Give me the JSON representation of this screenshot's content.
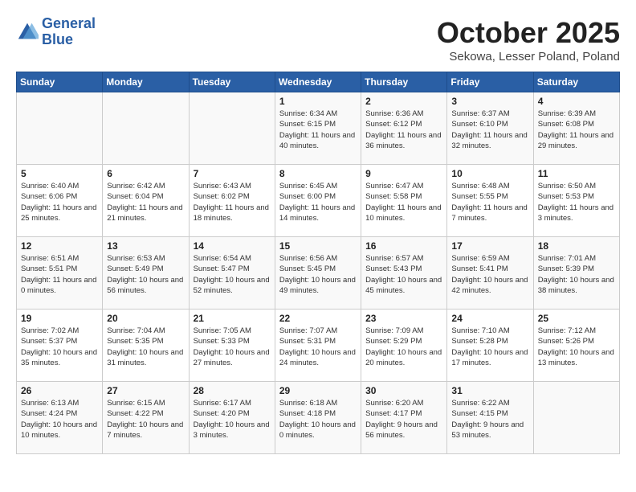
{
  "header": {
    "logo_line1": "General",
    "logo_line2": "Blue",
    "month": "October 2025",
    "location": "Sekowa, Lesser Poland, Poland"
  },
  "weekdays": [
    "Sunday",
    "Monday",
    "Tuesday",
    "Wednesday",
    "Thursday",
    "Friday",
    "Saturday"
  ],
  "weeks": [
    [
      {
        "day": "",
        "info": ""
      },
      {
        "day": "",
        "info": ""
      },
      {
        "day": "",
        "info": ""
      },
      {
        "day": "1",
        "info": "Sunrise: 6:34 AM\nSunset: 6:15 PM\nDaylight: 11 hours\nand 40 minutes."
      },
      {
        "day": "2",
        "info": "Sunrise: 6:36 AM\nSunset: 6:12 PM\nDaylight: 11 hours\nand 36 minutes."
      },
      {
        "day": "3",
        "info": "Sunrise: 6:37 AM\nSunset: 6:10 PM\nDaylight: 11 hours\nand 32 minutes."
      },
      {
        "day": "4",
        "info": "Sunrise: 6:39 AM\nSunset: 6:08 PM\nDaylight: 11 hours\nand 29 minutes."
      }
    ],
    [
      {
        "day": "5",
        "info": "Sunrise: 6:40 AM\nSunset: 6:06 PM\nDaylight: 11 hours\nand 25 minutes."
      },
      {
        "day": "6",
        "info": "Sunrise: 6:42 AM\nSunset: 6:04 PM\nDaylight: 11 hours\nand 21 minutes."
      },
      {
        "day": "7",
        "info": "Sunrise: 6:43 AM\nSunset: 6:02 PM\nDaylight: 11 hours\nand 18 minutes."
      },
      {
        "day": "8",
        "info": "Sunrise: 6:45 AM\nSunset: 6:00 PM\nDaylight: 11 hours\nand 14 minutes."
      },
      {
        "day": "9",
        "info": "Sunrise: 6:47 AM\nSunset: 5:58 PM\nDaylight: 11 hours\nand 10 minutes."
      },
      {
        "day": "10",
        "info": "Sunrise: 6:48 AM\nSunset: 5:55 PM\nDaylight: 11 hours\nand 7 minutes."
      },
      {
        "day": "11",
        "info": "Sunrise: 6:50 AM\nSunset: 5:53 PM\nDaylight: 11 hours\nand 3 minutes."
      }
    ],
    [
      {
        "day": "12",
        "info": "Sunrise: 6:51 AM\nSunset: 5:51 PM\nDaylight: 11 hours\nand 0 minutes."
      },
      {
        "day": "13",
        "info": "Sunrise: 6:53 AM\nSunset: 5:49 PM\nDaylight: 10 hours\nand 56 minutes."
      },
      {
        "day": "14",
        "info": "Sunrise: 6:54 AM\nSunset: 5:47 PM\nDaylight: 10 hours\nand 52 minutes."
      },
      {
        "day": "15",
        "info": "Sunrise: 6:56 AM\nSunset: 5:45 PM\nDaylight: 10 hours\nand 49 minutes."
      },
      {
        "day": "16",
        "info": "Sunrise: 6:57 AM\nSunset: 5:43 PM\nDaylight: 10 hours\nand 45 minutes."
      },
      {
        "day": "17",
        "info": "Sunrise: 6:59 AM\nSunset: 5:41 PM\nDaylight: 10 hours\nand 42 minutes."
      },
      {
        "day": "18",
        "info": "Sunrise: 7:01 AM\nSunset: 5:39 PM\nDaylight: 10 hours\nand 38 minutes."
      }
    ],
    [
      {
        "day": "19",
        "info": "Sunrise: 7:02 AM\nSunset: 5:37 PM\nDaylight: 10 hours\nand 35 minutes."
      },
      {
        "day": "20",
        "info": "Sunrise: 7:04 AM\nSunset: 5:35 PM\nDaylight: 10 hours\nand 31 minutes."
      },
      {
        "day": "21",
        "info": "Sunrise: 7:05 AM\nSunset: 5:33 PM\nDaylight: 10 hours\nand 27 minutes."
      },
      {
        "day": "22",
        "info": "Sunrise: 7:07 AM\nSunset: 5:31 PM\nDaylight: 10 hours\nand 24 minutes."
      },
      {
        "day": "23",
        "info": "Sunrise: 7:09 AM\nSunset: 5:29 PM\nDaylight: 10 hours\nand 20 minutes."
      },
      {
        "day": "24",
        "info": "Sunrise: 7:10 AM\nSunset: 5:28 PM\nDaylight: 10 hours\nand 17 minutes."
      },
      {
        "day": "25",
        "info": "Sunrise: 7:12 AM\nSunset: 5:26 PM\nDaylight: 10 hours\nand 13 minutes."
      }
    ],
    [
      {
        "day": "26",
        "info": "Sunrise: 6:13 AM\nSunset: 4:24 PM\nDaylight: 10 hours\nand 10 minutes."
      },
      {
        "day": "27",
        "info": "Sunrise: 6:15 AM\nSunset: 4:22 PM\nDaylight: 10 hours\nand 7 minutes."
      },
      {
        "day": "28",
        "info": "Sunrise: 6:17 AM\nSunset: 4:20 PM\nDaylight: 10 hours\nand 3 minutes."
      },
      {
        "day": "29",
        "info": "Sunrise: 6:18 AM\nSunset: 4:18 PM\nDaylight: 10 hours\nand 0 minutes."
      },
      {
        "day": "30",
        "info": "Sunrise: 6:20 AM\nSunset: 4:17 PM\nDaylight: 9 hours\nand 56 minutes."
      },
      {
        "day": "31",
        "info": "Sunrise: 6:22 AM\nSunset: 4:15 PM\nDaylight: 9 hours\nand 53 minutes."
      },
      {
        "day": "",
        "info": ""
      }
    ]
  ]
}
